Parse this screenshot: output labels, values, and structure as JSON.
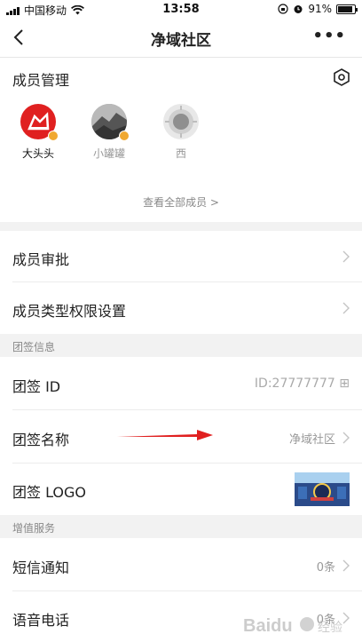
{
  "status_bar": {
    "carrier": "中国移动",
    "time": "13:58",
    "battery": "91%",
    "battery_level": 0.91
  },
  "navbar": {
    "title": "净域社区"
  },
  "members": {
    "title": "成员管理",
    "list": [
      {
        "name": "大头头"
      },
      {
        "name": "小罐罐"
      },
      {
        "name": "西"
      }
    ],
    "see_all": "查看全部成员 >"
  },
  "rows": {
    "member_approval": "成员审批",
    "member_type_permissions": "成员类型权限设置"
  },
  "group_info": {
    "section_label": "团签信息",
    "id_label": "团签 ID",
    "id_value": "ID:27777777 ⊞",
    "name_label": "团签名称",
    "name_value": "净域社区",
    "logo_label": "团签 LOGO"
  },
  "value_added": {
    "section_label": "增值服务",
    "sms_label": "短信通知",
    "sms_value": "0条",
    "voice_label": "语音电话",
    "voice_value": "0条"
  },
  "colors": {
    "accent_red": "#e02020",
    "badge_gold": "#f0a830",
    "text_gray": "#999999"
  },
  "watermark": {
    "text": "Baidu经验"
  }
}
